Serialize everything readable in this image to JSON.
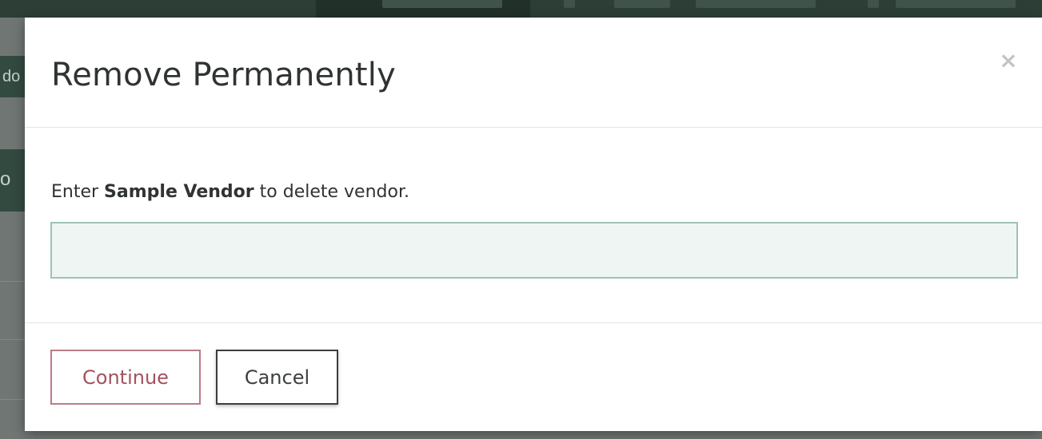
{
  "modal": {
    "title": "Remove Permanently",
    "close_icon": "close-icon",
    "close_glyph": "×",
    "instruction": {
      "prefix": "Enter ",
      "vendor_name": "Sample Vendor",
      "suffix": " to delete vendor."
    },
    "confirm_input": {
      "value": "",
      "placeholder": ""
    },
    "buttons": {
      "continue_label": "Continue",
      "cancel_label": "Cancel"
    }
  },
  "background": {
    "left_strip_fragments": [
      "do",
      "o"
    ]
  },
  "colors": {
    "accent_green_border": "#9dc4b3",
    "input_background": "#eff5f2",
    "continue_border": "#b97c86",
    "continue_text": "#a5515e",
    "app_header": "#2c3e36"
  }
}
